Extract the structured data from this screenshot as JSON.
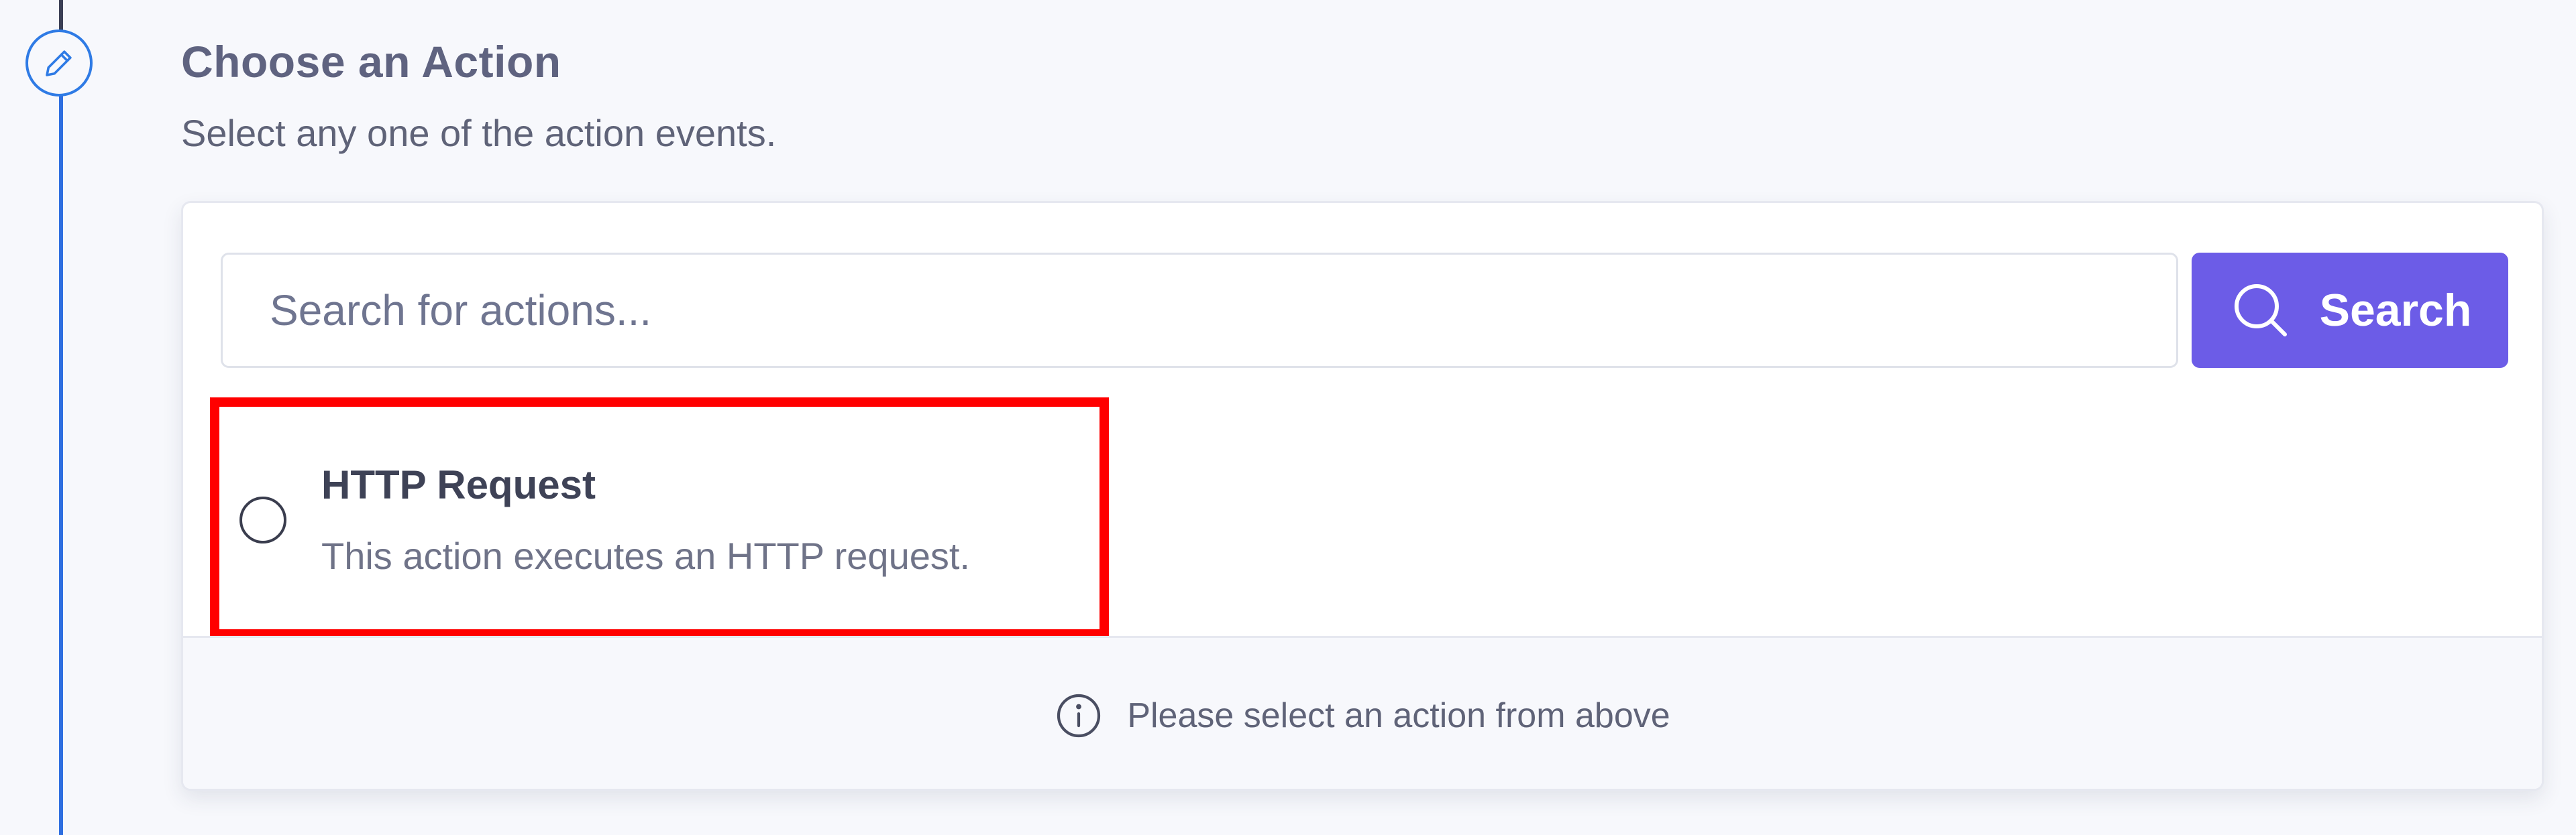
{
  "step": {
    "icon": "pencil-icon",
    "title": "Choose an Action",
    "subtitle": "Select any one of the action events."
  },
  "search": {
    "placeholder": "Search for actions...",
    "value": "",
    "button_label": "Search",
    "button_icon": "search-icon",
    "button_color": "#6c5ce7"
  },
  "actions": [
    {
      "title": "HTTP Request",
      "description": "This action executes an HTTP request.",
      "selected": false
    }
  ],
  "footer": {
    "icon": "info-icon",
    "message": "Please select an action from above"
  },
  "colors": {
    "accent": "#2f7be5",
    "highlight": "#ff0000"
  }
}
